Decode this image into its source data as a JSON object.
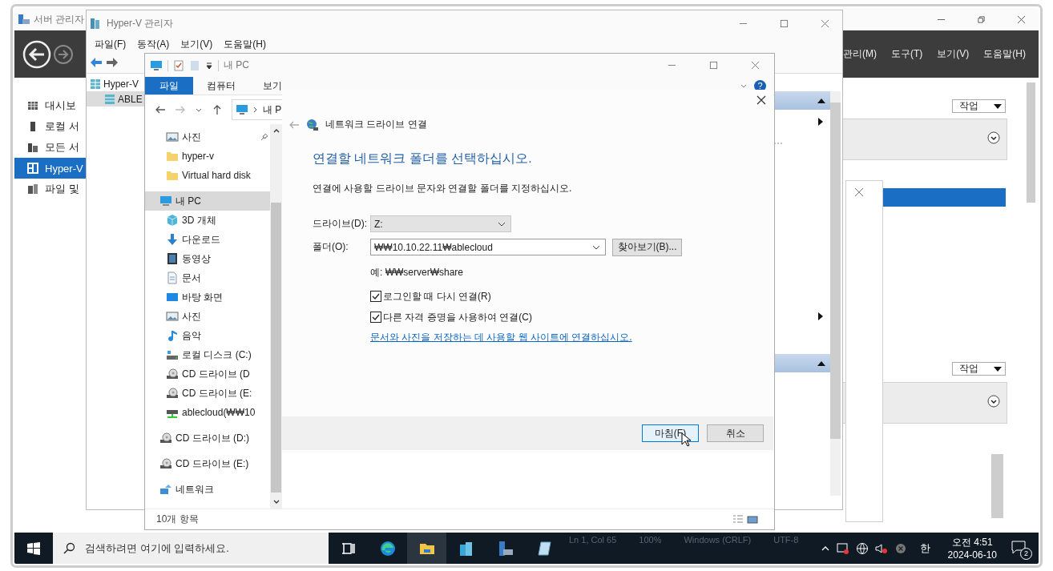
{
  "server_manager": {
    "title": "서버 관리자",
    "menu": [
      "관리(M)",
      "도구(T)",
      "보기(V)",
      "도움말(H)"
    ],
    "nav": [
      {
        "label": "대시보",
        "kind": "grid",
        "selected": false
      },
      {
        "label": "로컬 서",
        "kind": "server",
        "selected": false
      },
      {
        "label": "모든 서",
        "kind": "servers",
        "selected": false
      },
      {
        "label": "Hyper-V",
        "kind": "hyperv",
        "selected": true
      },
      {
        "label": "파일 및",
        "kind": "files",
        "selected": false
      }
    ],
    "task_buttons": [
      "작업",
      "작업"
    ]
  },
  "hyperv": {
    "title": "Hyper-V 관리자",
    "menu": [
      "파일(F)",
      "동작(A)",
      "보기(V)",
      "도움말(H)"
    ],
    "tree": [
      {
        "label": "Hyper-V",
        "selected": false,
        "children": [
          {
            "label": "ABLE",
            "selected": true
          }
        ]
      }
    ]
  },
  "explorer": {
    "title": "내 PC",
    "tabs": [
      {
        "label": "파일",
        "selected": true
      },
      {
        "label": "컴퓨터",
        "selected": false
      },
      {
        "label": "보기",
        "selected": false
      }
    ],
    "address": "내 P",
    "help_badge": "?",
    "quick_access": [
      {
        "label": "사진",
        "kind": "picture",
        "pinned": true,
        "selected": false
      },
      {
        "label": "hyper-v",
        "kind": "folder",
        "pinned": false,
        "selected": false
      },
      {
        "label": "Virtual hard disk",
        "kind": "folder",
        "pinned": false,
        "selected": false
      }
    ],
    "tree": [
      {
        "label": "내 PC",
        "kind": "pc",
        "selected": true,
        "children": [
          {
            "label": "3D 개체",
            "kind": "cube",
            "selected": false
          },
          {
            "label": "다운로드",
            "kind": "download",
            "selected": false
          },
          {
            "label": "동영상",
            "kind": "video",
            "selected": false
          },
          {
            "label": "문서",
            "kind": "document",
            "selected": false
          },
          {
            "label": "바탕 화면",
            "kind": "desktop",
            "selected": false
          },
          {
            "label": "사진",
            "kind": "picture",
            "selected": false
          },
          {
            "label": "음악",
            "kind": "music",
            "selected": false
          },
          {
            "label": "로컬 디스크 (C:)",
            "kind": "disk",
            "selected": false
          },
          {
            "label": "CD 드라이브 (D",
            "kind": "cd",
            "selected": false
          },
          {
            "label": "CD 드라이브 (E:",
            "kind": "cd",
            "selected": false
          },
          {
            "label": "ablecloud(₩₩10",
            "kind": "netdrive",
            "selected": false
          }
        ]
      },
      {
        "label": "CD 드라이브 (D:)",
        "kind": "cd",
        "selected": false
      },
      {
        "label": "CD 드라이브 (E:)",
        "kind": "cd",
        "selected": false
      },
      {
        "label": "네트워크",
        "kind": "network",
        "selected": false
      }
    ],
    "status": "10개 항목"
  },
  "dialog": {
    "title": "네트워크 드라이브 연결",
    "heading": "연결할 네트워크 폴더를 선택하십시오.",
    "instruction": "연결에 사용할 드라이브 문자와 연결할 폴더를 지정하십시오.",
    "drive_label": "드라이브(D):",
    "drive_value": "Z:",
    "folder_label": "폴더(O):",
    "folder_value": "₩₩10.10.22.11₩ablecloud",
    "browse": "찾아보기(B)...",
    "example": "예: ₩₩server₩share",
    "options": [
      {
        "label": "로그인할 때 다시 연결(R)",
        "checked": true
      },
      {
        "label": "다른 자격 증명을 사용하여 연결(C)",
        "checked": true
      }
    ],
    "link": "문서와 사진을 저장하는 데 사용할 웹 사이트에 연결하십시오.",
    "buttons": [
      {
        "label": "마침(F)",
        "kind": "default"
      },
      {
        "label": "취소",
        "kind": "normal"
      }
    ]
  },
  "taskbar": {
    "search_placeholder": "검색하려면 여기에 입력하세요.",
    "apps": [
      {
        "kind": "taskview",
        "active": false
      },
      {
        "kind": "edge",
        "active": false
      },
      {
        "kind": "explorer",
        "active": true
      },
      {
        "kind": "buildings",
        "active": false
      },
      {
        "kind": "servermgr",
        "active": false
      },
      {
        "kind": "notepad",
        "active": false
      }
    ],
    "background_status": [
      "Ln 1, Col 65",
      "100%",
      "Windows (CRLF)",
      "UTF-8"
    ],
    "ime": "한",
    "time": "오전 4:51",
    "date": "2024-06-10",
    "notifications": "2"
  }
}
